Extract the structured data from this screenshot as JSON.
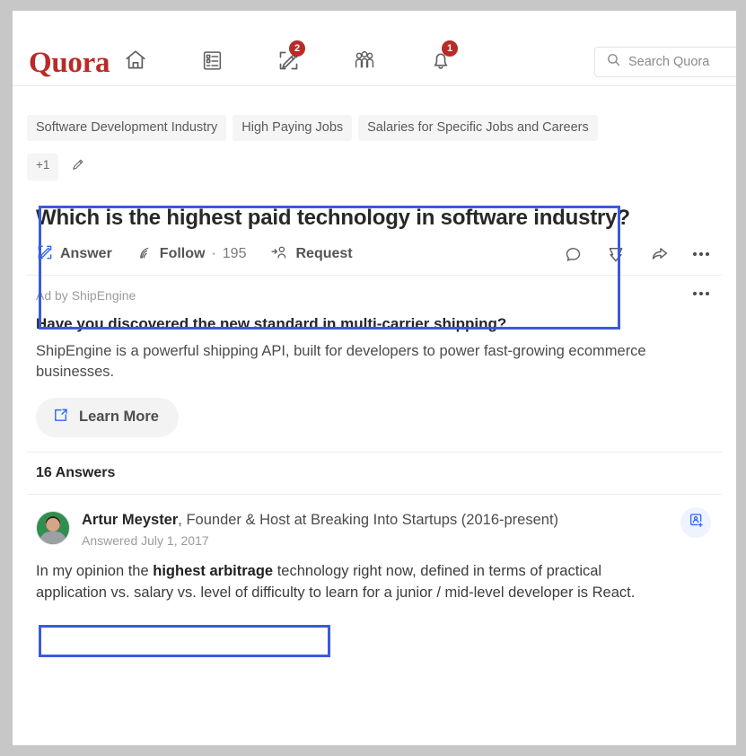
{
  "header": {
    "logo": "Quora",
    "nav": [
      {
        "name": "home-icon",
        "badge": null
      },
      {
        "name": "answer-feed-icon",
        "badge": null
      },
      {
        "name": "write-answer-icon",
        "badge": "2"
      },
      {
        "name": "spaces-icon",
        "badge": null
      },
      {
        "name": "notifications-bell-icon",
        "badge": "1"
      }
    ],
    "search": {
      "placeholder": "Search Quora",
      "value": "",
      "icon": "search-icon"
    }
  },
  "topics": {
    "chips": [
      "Software Development Industry",
      "High Paying Jobs",
      "Salaries for Specific Jobs and Careers"
    ],
    "more_label": "+1",
    "edit_icon": "pencil-edit-icon"
  },
  "question": {
    "title": "Which is the highest paid technology in software industry?",
    "actions": {
      "answer_label": "Answer",
      "answer_icon": "pencil-answer-icon",
      "follow_label": "Follow",
      "follow_separator": "·",
      "follow_count": "195",
      "follow_icon": "follow-rss-icon",
      "request_label": "Request",
      "request_icon": "request-person-icon"
    },
    "right_icons": [
      "comment-icon",
      "downvote-icon",
      "share-icon",
      "more-options-icon"
    ]
  },
  "ad": {
    "sponsor_label": "Ad by ShipEngine",
    "more_icon": "more-options-icon",
    "title": "Have you discovered the new standard in multi-carrier shipping?",
    "description": "ShipEngine is a powerful shipping API, built for developers to power fast-growing ecommerce businesses.",
    "cta_label": "Learn More",
    "cta_icon": "external-link-icon"
  },
  "answers": {
    "count_label": "16 Answers",
    "first": {
      "author_name": "Artur Meyster",
      "author_credential": ", Founder & Host at Breaking Into Startups (2016-present)",
      "answered_on": "Answered July 1, 2017",
      "follow_button_icon": "add-person-icon",
      "body_prefix": "In my opinion the ",
      "body_bold": "highest arbitrage",
      "body_suffix": " technology right now, defined in terms of practical application vs. salary vs. level of difficulty to learn for a junior / mid-level developer is React."
    }
  },
  "highlights": {
    "color": "#3b5bdb",
    "regions": [
      "question-card",
      "answer-first-line"
    ]
  }
}
